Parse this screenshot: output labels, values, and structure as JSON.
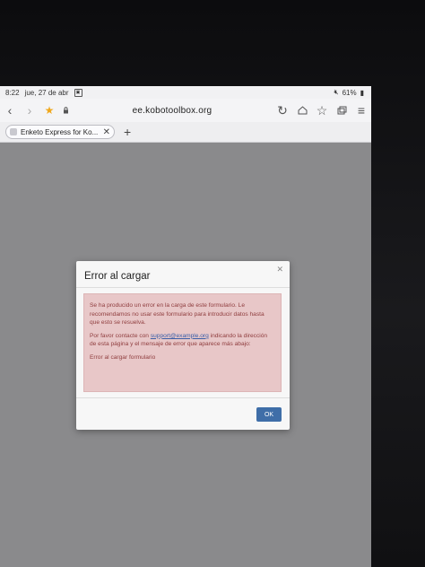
{
  "status": {
    "time": "8:22",
    "date": "jue, 27 de abr",
    "battery": "61%"
  },
  "toolbar": {
    "url": "ee.kobotoolbox.org"
  },
  "tabs": [
    {
      "label": "Enketo Express for Ko..."
    }
  ],
  "modal": {
    "title": "Error al cargar",
    "message_1": "Se ha producido un error en la carga de este formulario. Le recomendamos no usar este formulario para introducir datos hasta que esto se resuelva.",
    "message_2_before": "Por favor contacte con ",
    "message_2_link": "support@example.org",
    "message_2_after": " indicando la dirección de esta página y el mensaje de error que aparece más abajo:",
    "error_text": "Error al cargar formulario",
    "ok_label": "OK"
  },
  "colors": {
    "alert_bg": "#e8c7c8",
    "alert_text": "#8f3d3e",
    "ok_button": "#3f6ea8",
    "star": "#f0a81c"
  }
}
